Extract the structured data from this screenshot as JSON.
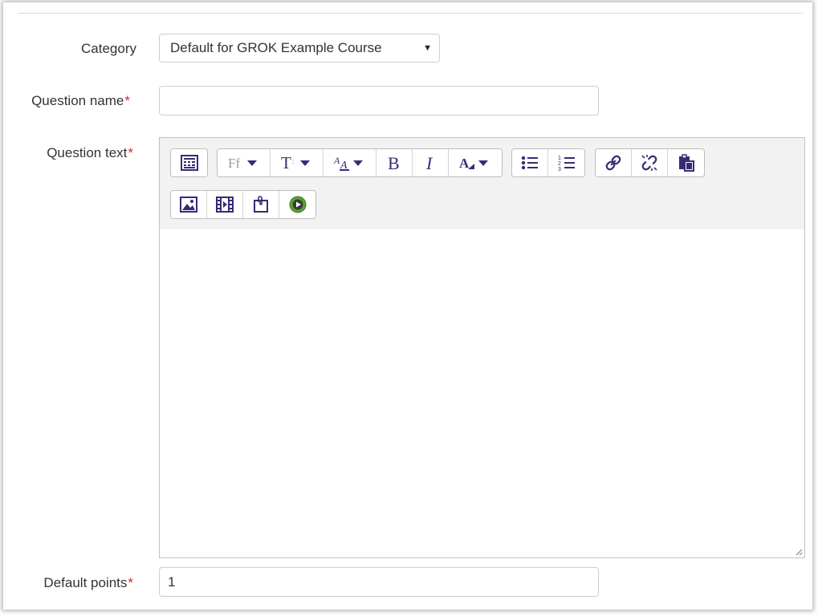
{
  "form": {
    "category": {
      "label": "Category",
      "selected": "Default for GROK Example Course"
    },
    "question_name": {
      "label": "Question name",
      "required_marker": "*",
      "value": ""
    },
    "question_text": {
      "label": "Question text",
      "required_marker": "*",
      "toolbar": {
        "row1": [
          {
            "name": "toolbar-toggle",
            "icon": "toolbar-toggle-icon"
          },
          {
            "name": "font-family",
            "icon": "font-family-icon",
            "glyph": "Ff"
          },
          {
            "name": "font-size",
            "icon": "font-size-icon",
            "glyph": "T"
          },
          {
            "name": "paragraph-style",
            "icon": "style-icon",
            "glyph": "A"
          },
          {
            "name": "bold",
            "icon": "bold-icon",
            "glyph": "B"
          },
          {
            "name": "italic",
            "icon": "italic-icon",
            "glyph": "I"
          },
          {
            "name": "text-color",
            "icon": "text-color-icon",
            "glyph": "A"
          },
          {
            "name": "unordered-list",
            "icon": "bullet-list-icon"
          },
          {
            "name": "ordered-list",
            "icon": "numbered-list-icon"
          },
          {
            "name": "insert-link",
            "icon": "link-icon"
          },
          {
            "name": "remove-link",
            "icon": "unlink-icon"
          },
          {
            "name": "paste",
            "icon": "paste-icon"
          }
        ],
        "row2": [
          {
            "name": "insert-image",
            "icon": "image-icon"
          },
          {
            "name": "insert-media",
            "icon": "film-icon"
          },
          {
            "name": "manage-files",
            "icon": "files-icon"
          },
          {
            "name": "record-media",
            "icon": "play-record-icon"
          }
        ]
      },
      "value": ""
    },
    "default_points": {
      "label": "Default points",
      "required_marker": "*",
      "value": "1"
    }
  },
  "colors": {
    "icon_purple": "#3b2a73",
    "required_red": "#d9262b",
    "record_green": "#5aa52e"
  }
}
